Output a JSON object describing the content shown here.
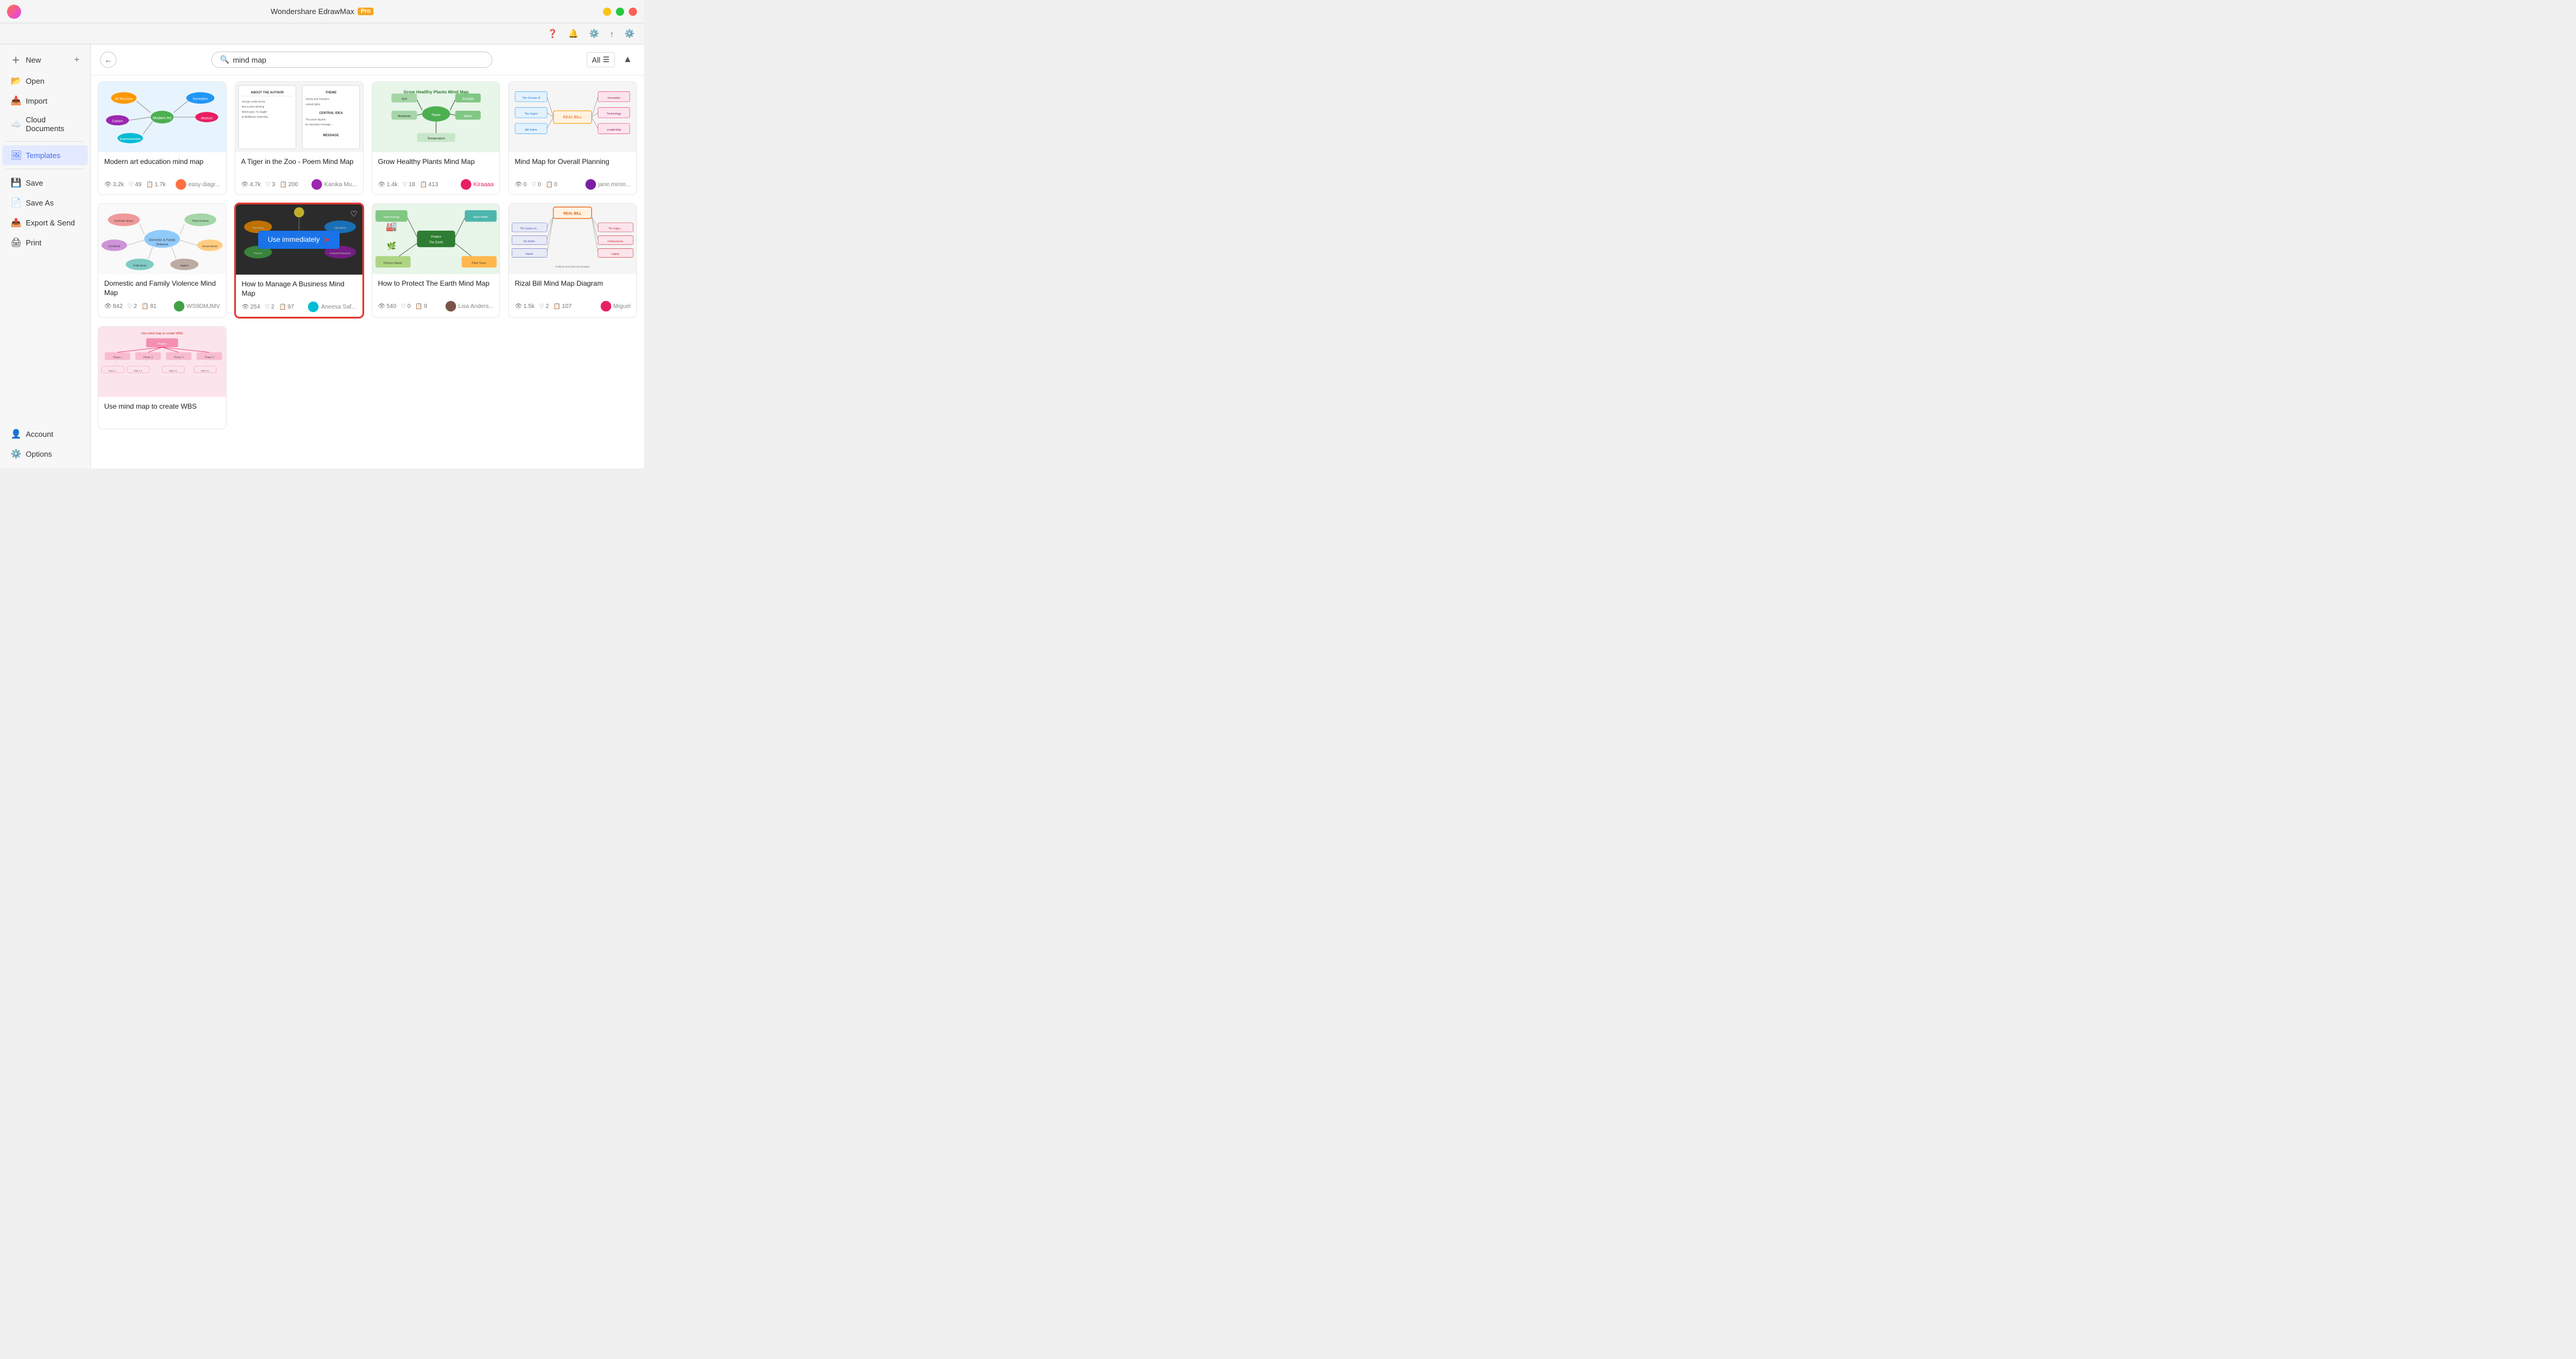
{
  "app": {
    "title": "Wondershare EdrawMax",
    "pro_label": "Pro"
  },
  "search": {
    "placeholder": "mind map",
    "value": "mind map",
    "filter_label": "All"
  },
  "sidebar": {
    "items": [
      {
        "id": "new",
        "label": "New",
        "icon": "➕",
        "has_plus": true
      },
      {
        "id": "open",
        "label": "Open",
        "icon": "📂",
        "has_plus": false
      },
      {
        "id": "import",
        "label": "Import",
        "icon": "📥",
        "has_plus": false
      },
      {
        "id": "cloud",
        "label": "Cloud Documents",
        "icon": "☁️",
        "has_plus": false
      },
      {
        "id": "templates",
        "label": "Templates",
        "icon": "🖼",
        "has_plus": false,
        "active": true
      },
      {
        "id": "save",
        "label": "Save",
        "icon": "💾",
        "has_plus": false
      },
      {
        "id": "saveas",
        "label": "Save As",
        "icon": "📄",
        "has_plus": false
      },
      {
        "id": "export",
        "label": "Export & Send",
        "icon": "📤",
        "has_plus": false
      },
      {
        "id": "print",
        "label": "Print",
        "icon": "🖨",
        "has_plus": false
      },
      {
        "id": "account",
        "label": "Account",
        "icon": "👤",
        "has_plus": false
      },
      {
        "id": "options",
        "label": "Options",
        "icon": "⚙️",
        "has_plus": false
      }
    ]
  },
  "cards": [
    {
      "id": "card1",
      "title": "Modern art education mind map",
      "views": "3.2k",
      "likes": "49",
      "copies": "1.7k",
      "author": "easy diagr...",
      "highlighted": false,
      "thumb_bg": "#e8f4fd",
      "thumb_type": "colorful_mindmap"
    },
    {
      "id": "card2",
      "title": "A Tiger in the Zoo - Poem Mind Map",
      "views": "4.7k",
      "likes": "3",
      "copies": "200",
      "author": "Kanika Mu...",
      "highlighted": false,
      "thumb_bg": "#f5f5f5",
      "thumb_type": "text_mindmap"
    },
    {
      "id": "card3",
      "title": "Grow Healthy Plants Mind Map",
      "views": "1.4k",
      "likes": "18",
      "copies": "413",
      "author": "Kiraaaa",
      "author_color": "#e91e63",
      "highlighted": false,
      "thumb_bg": "#e8f5e9",
      "thumb_type": "plant_mindmap"
    },
    {
      "id": "card4",
      "title": "Mind Map for Overall Planning",
      "views": "0",
      "likes": "0",
      "copies": "0",
      "author": "jane.miron...",
      "highlighted": false,
      "thumb_bg": "#f5f5f5",
      "thumb_type": "planning_mindmap"
    },
    {
      "id": "card5",
      "title": "Domestic and Family Violence Mind Map",
      "views": "842",
      "likes": "2",
      "copies": "81",
      "author": "WS9DMJMV",
      "highlighted": false,
      "thumb_bg": "#f9f9f9",
      "thumb_type": "violence_mindmap"
    },
    {
      "id": "card6",
      "title": "How to Manage A Business Mind Map",
      "views": "254",
      "likes": "2",
      "copies": "97",
      "author": "Aneesa Saf...",
      "highlighted": true,
      "thumb_bg": "#3a3a3a",
      "thumb_type": "business_mindmap",
      "use_immediately_label": "Use immediately"
    },
    {
      "id": "card7",
      "title": "How to Protect The Earth Mind Map",
      "views": "540",
      "likes": "0",
      "copies": "9",
      "author": "Lisa Anders...",
      "highlighted": false,
      "thumb_bg": "#e8f5e9",
      "thumb_type": "earth_mindmap"
    },
    {
      "id": "card8",
      "title": "Rizal Bill Mind Map Diagram",
      "views": "1.5k",
      "likes": "2",
      "copies": "107",
      "author": "Miguel",
      "highlighted": false,
      "thumb_bg": "#f5f5f5",
      "thumb_type": "rizal_mindmap"
    },
    {
      "id": "card9",
      "title": "Use mind map to create WBS",
      "views": "",
      "likes": "",
      "copies": "",
      "author": "",
      "highlighted": false,
      "thumb_bg": "#fce4ec",
      "thumb_type": "wbs_mindmap"
    }
  ]
}
